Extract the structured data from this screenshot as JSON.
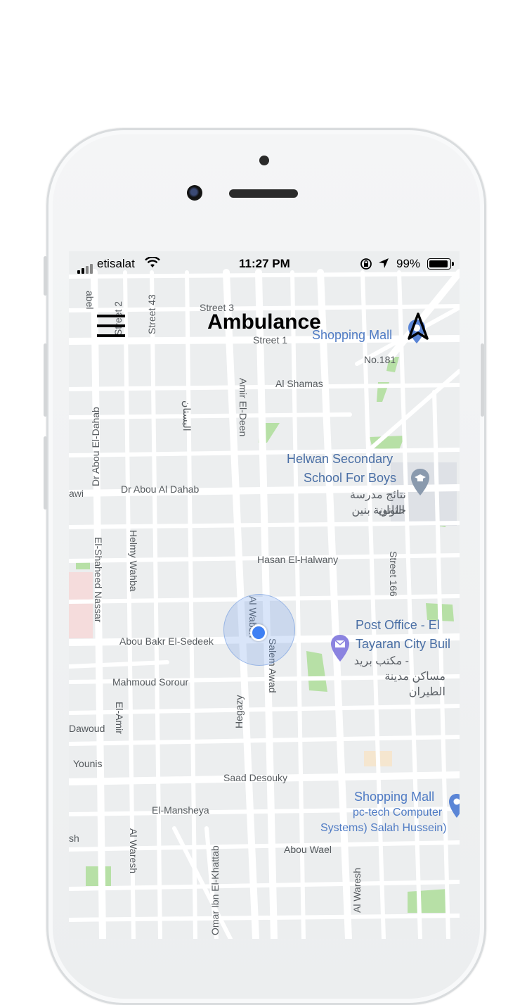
{
  "status_bar": {
    "carrier": "etisalat",
    "time": "11:27 PM",
    "battery": "99%"
  },
  "header": {
    "title": "Ambulance"
  },
  "map": {
    "street_labels": [
      "Street 3",
      "Street 2",
      "Street 43",
      "Street 1",
      "No.181",
      "Al Shamas",
      "Amir El-Deen",
      "البستان",
      "Dr Abou El-Dahab",
      "Dr Abou Al Dahab",
      "Hasan El-Halwany",
      "Helmy Wahba",
      "El-Shaheed Nassar",
      "Street 166",
      "Abou Bakr El-Sedeek",
      "Al Wabsh",
      "Salem Awad",
      "Mahmoud Sorour",
      "Hegazy",
      "El-Amir",
      "Dawoud",
      "Younis",
      "Saad Desouky",
      "El-Mansheya",
      "Al Waresh",
      "Omar Ibn El-Khattab",
      "Abou Wael",
      "Al Waresh",
      "awi",
      "sh",
      "abel"
    ],
    "pois": {
      "shopping_mall_top": "Shopping Mall",
      "school_en_1": "Helwan Secondary",
      "school_en_2": "School For Boys",
      "school_ar_1": "نتائج مدرسة حلوان",
      "school_ar_2": "الثانوية بنين",
      "post_en_1": "Post Office - El",
      "post_en_2": "Tayaran City Buil",
      "post_ar_1": "مكتب بريد -",
      "post_ar_2": "مساكن مدينة الطيران",
      "shopping_mall_bottom": "Shopping Mall",
      "pctech_1": "pc-tech Computer",
      "pctech_2": "Systems) Salah Hussein)"
    },
    "colors": {
      "background": "#eceeef",
      "road": "#ffffff",
      "park": "#b7e0a6",
      "poi_blue": "#4f7bc4",
      "user_location": "#3f80f3"
    }
  }
}
